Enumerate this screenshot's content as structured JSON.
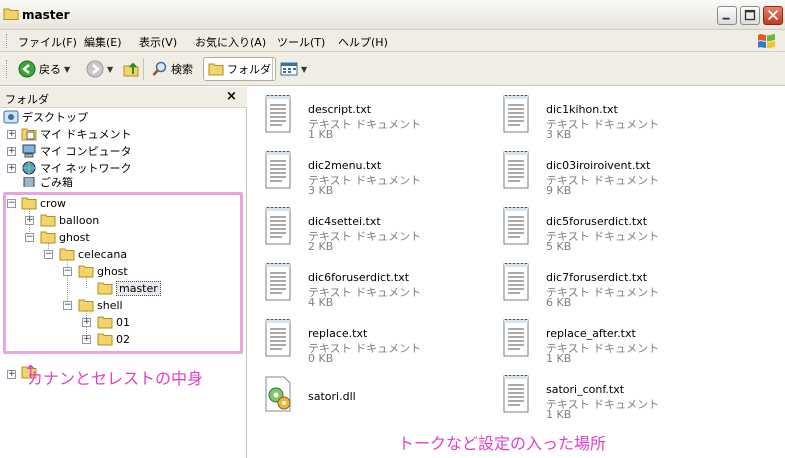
{
  "window": {
    "title": "master"
  },
  "menu": [
    "ファイル(F)",
    "編集(E)",
    "表示(V)",
    "お気に入り(A)",
    "ツール(T)",
    "ヘルプ(H)"
  ],
  "toolbar": {
    "back_label": "戻る",
    "search_label": "検索",
    "folders_label": "フォルダ"
  },
  "folder_pane": {
    "title": "フォルダ",
    "close": "×",
    "top_items": [
      "デスクトップ",
      "マイ ドキュメント",
      "マイ コンピュータ",
      "マイ ネットワーク",
      "ごみ箱"
    ],
    "tree": {
      "crow": "crow",
      "balloon": "balloon",
      "ghost": "ghost",
      "celecana": "celecana",
      "ghost2": "ghost",
      "master": "master",
      "shell": "shell",
      "s01": "01",
      "s02": "02"
    },
    "annotation": "カナンとセレストの中身",
    "arrow": "↑"
  },
  "files": [
    {
      "name": "descript.txt",
      "type": "テキスト ドキュメント",
      "size": "1 KB",
      "icon": "text-document-icon"
    },
    {
      "name": "dic1kihon.txt",
      "type": "テキスト ドキュメント",
      "size": "3 KB",
      "icon": "text-document-icon"
    },
    {
      "name": "dic2menu.txt",
      "type": "テキスト ドキュメント",
      "size": "3 KB",
      "icon": "text-document-icon"
    },
    {
      "name": "dic03iroiroivent.txt",
      "type": "テキスト ドキュメント",
      "size": "9 KB",
      "icon": "text-document-icon"
    },
    {
      "name": "dic4settei.txt",
      "type": "テキスト ドキュメント",
      "size": "2 KB",
      "icon": "text-document-icon"
    },
    {
      "name": "dic5foruserdict.txt",
      "type": "テキスト ドキュメント",
      "size": "5 KB",
      "icon": "text-document-icon"
    },
    {
      "name": "dic6foruserdict.txt",
      "type": "テキスト ドキュメント",
      "size": "4 KB",
      "icon": "text-document-icon"
    },
    {
      "name": "dic7foruserdict.txt",
      "type": "テキスト ドキュメント",
      "size": "6 KB",
      "icon": "text-document-icon"
    },
    {
      "name": "replace.txt",
      "type": "テキスト ドキュメント",
      "size": "0 KB",
      "icon": "text-document-icon"
    },
    {
      "name": "replace_after.txt",
      "type": "テキスト ドキュメント",
      "size": "1 KB",
      "icon": "text-document-icon"
    },
    {
      "name": "satori.dll",
      "type": "",
      "size": "",
      "icon": "dll-gear-icon"
    },
    {
      "name": "satori_conf.txt",
      "type": "テキスト ドキュメント",
      "size": "1 KB",
      "icon": "text-document-icon"
    }
  ],
  "file_annotation": "トークなど設定の入った場所",
  "colors": {
    "annotation": "#e040c8",
    "highlight_box": "#e8a6dc"
  }
}
